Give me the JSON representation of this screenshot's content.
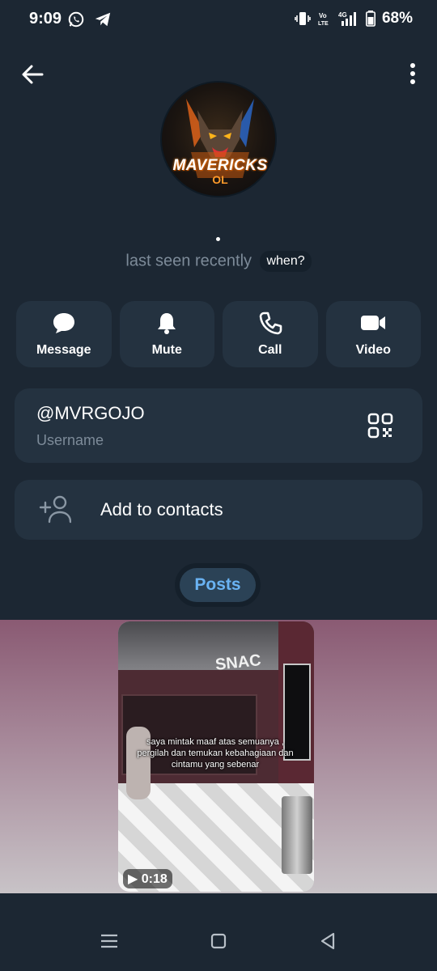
{
  "status_bar": {
    "time": "9:09",
    "volte_label": "Vo LTE",
    "network_label": "4G",
    "battery": "68%"
  },
  "profile": {
    "avatar_title": "MAVERICKS",
    "avatar_sub": "OL",
    "presence": "last seen recently",
    "when_label": "when?"
  },
  "actions": [
    {
      "label": "Message",
      "icon": "message-bubble-icon"
    },
    {
      "label": "Mute",
      "icon": "bell-icon"
    },
    {
      "label": "Call",
      "icon": "phone-icon"
    },
    {
      "label": "Video",
      "icon": "video-camera-icon"
    }
  ],
  "username_card": {
    "value": "@MVRGOJO",
    "caption": "Username"
  },
  "contacts": {
    "label": "Add to contacts"
  },
  "tabs": {
    "posts": "Posts"
  },
  "post": {
    "sign_text": "SNAC",
    "caption": "saya mintak maaf atas semuanya , pergilah dan temukan kebahagiaan dan cintamu yang sebenar",
    "duration": "▶ 0:18"
  },
  "colors": {
    "background": "#1c2733",
    "card": "#243240",
    "accent": "#6ab3f3",
    "muted_text": "#7d8b99"
  }
}
